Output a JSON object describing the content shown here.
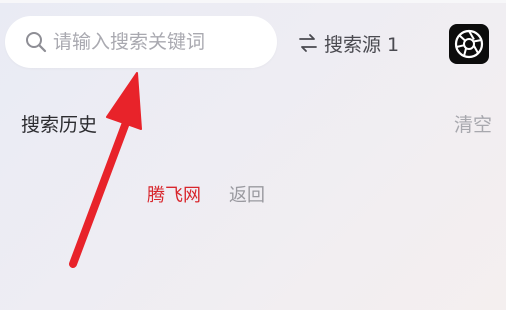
{
  "search": {
    "placeholder": "请输入搜索关键词",
    "value": ""
  },
  "source": {
    "label": "搜索源 1"
  },
  "history": {
    "title": "搜索历史",
    "clear_label": "清空",
    "items": [
      {
        "label": "腾飞网"
      },
      {
        "label": "返回"
      }
    ]
  },
  "icons": {
    "search": "search-icon",
    "swap": "swap-arrows-icon",
    "settings": "aperture-icon"
  },
  "colors": {
    "annotation_arrow": "#e8232a",
    "watermark_text": "#d8262c",
    "settings_bg": "#0c0c0c"
  }
}
